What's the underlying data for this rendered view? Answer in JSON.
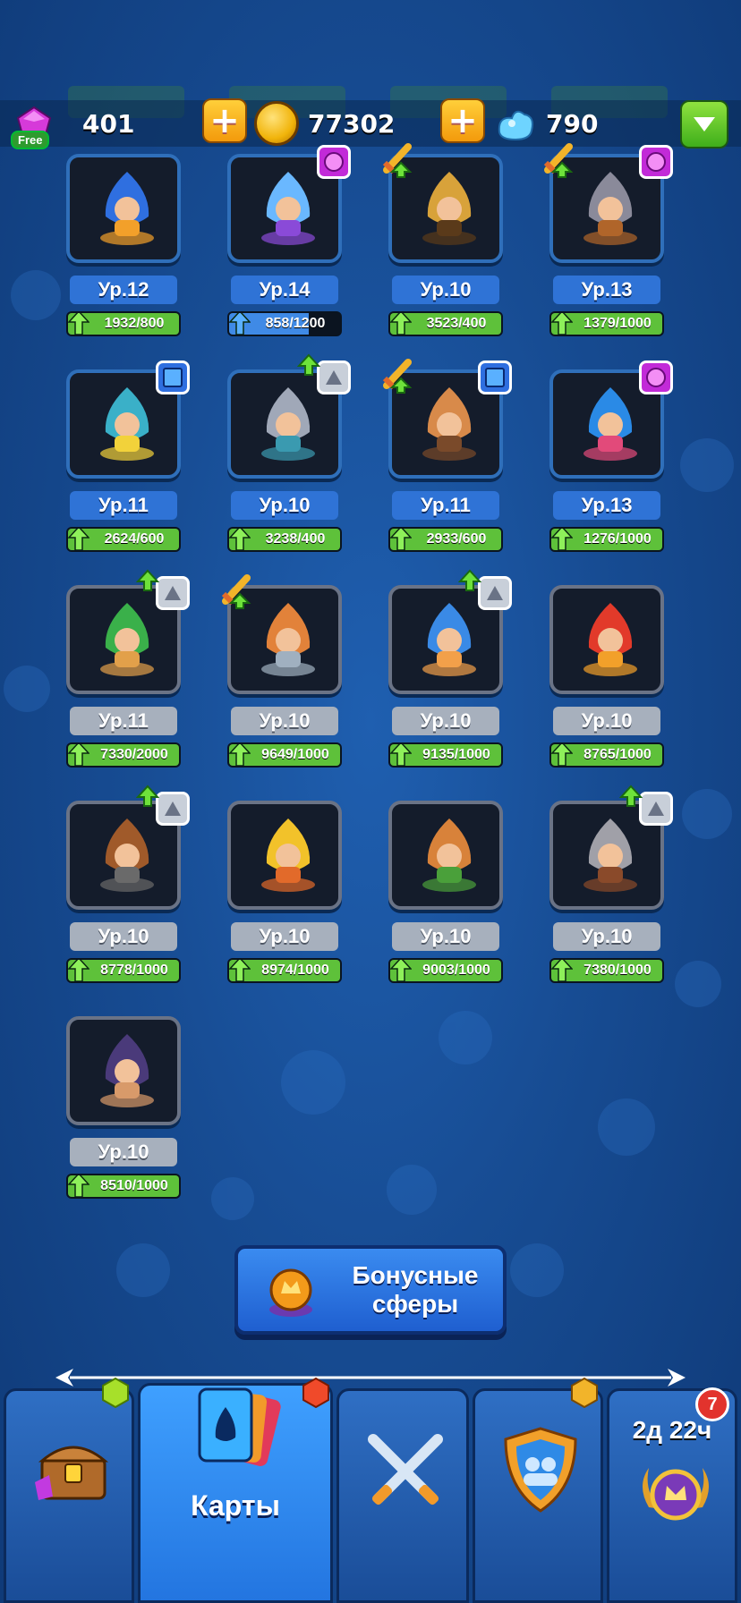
{
  "resources": {
    "gems": "401",
    "gems_free_label": "Free",
    "coins": "77302",
    "crystals": "790"
  },
  "colors": {
    "card_blue_border": "#2f6fba",
    "card_grey_border": "#6a7386",
    "level_blue": "#2f73d6",
    "level_grey": "#a7b0bd",
    "progress_green": "#5ec13a",
    "progress_blue": "#3f8ae6"
  },
  "cards": [
    {
      "level": "Ур.12",
      "progress": "1932/800",
      "fill": 1.0,
      "style": "blue",
      "badge": "",
      "sword": false,
      "up": false,
      "art": "banner",
      "bar": "green"
    },
    {
      "level": "Ур.14",
      "progress": "858/1200",
      "fill": 0.715,
      "style": "blue",
      "badge": "purple",
      "sword": false,
      "up": false,
      "art": "cauldron",
      "bar": "blue"
    },
    {
      "level": "Ур.10",
      "progress": "3523/400",
      "fill": 1.0,
      "style": "blue",
      "badge": "",
      "sword": true,
      "up": false,
      "art": "golem",
      "bar": "green"
    },
    {
      "level": "Ур.13",
      "progress": "1379/1000",
      "fill": 1.0,
      "style": "blue",
      "badge": "purple",
      "sword": true,
      "up": false,
      "art": "cannon",
      "bar": "green"
    },
    {
      "level": "Ур.11",
      "progress": "2624/600",
      "fill": 1.0,
      "style": "blue",
      "badge": "blue",
      "sword": false,
      "up": false,
      "art": "angel",
      "bar": "green"
    },
    {
      "level": "Ур.10",
      "progress": "3238/400",
      "fill": 1.0,
      "style": "blue",
      "badge": "grey",
      "sword": false,
      "up": true,
      "art": "knight",
      "bar": "green"
    },
    {
      "level": "Ур.11",
      "progress": "2933/600",
      "fill": 1.0,
      "style": "blue",
      "badge": "blue",
      "sword": true,
      "up": false,
      "art": "monk",
      "bar": "green"
    },
    {
      "level": "Ур.13",
      "progress": "1276/1000",
      "fill": 1.0,
      "style": "blue",
      "badge": "purple",
      "sword": false,
      "up": false,
      "art": "mage",
      "bar": "green"
    },
    {
      "level": "Ур.11",
      "progress": "7330/2000",
      "fill": 1.0,
      "style": "grey",
      "badge": "grey",
      "sword": false,
      "up": true,
      "art": "druid",
      "bar": "green"
    },
    {
      "level": "Ур.10",
      "progress": "9649/1000",
      "fill": 1.0,
      "style": "grey",
      "badge": "",
      "sword": true,
      "up": false,
      "art": "gasmask",
      "bar": "green"
    },
    {
      "level": "Ур.10",
      "progress": "9135/1000",
      "fill": 1.0,
      "style": "grey",
      "badge": "grey",
      "sword": false,
      "up": true,
      "art": "icemage",
      "bar": "green"
    },
    {
      "level": "Ур.10",
      "progress": "8765/1000",
      "fill": 1.0,
      "style": "grey",
      "badge": "",
      "sword": false,
      "up": false,
      "art": "firemage",
      "bar": "green"
    },
    {
      "level": "Ур.10",
      "progress": "8778/1000",
      "fill": 1.0,
      "style": "grey",
      "badge": "grey",
      "sword": false,
      "up": true,
      "art": "boar",
      "bar": "green"
    },
    {
      "level": "Ур.10",
      "progress": "8974/1000",
      "fill": 1.0,
      "style": "grey",
      "badge": "",
      "sword": false,
      "up": false,
      "art": "lightning",
      "bar": "green"
    },
    {
      "level": "Ур.10",
      "progress": "9003/1000",
      "fill": 1.0,
      "style": "grey",
      "badge": "",
      "sword": false,
      "up": false,
      "art": "shaman",
      "bar": "green"
    },
    {
      "level": "Ур.10",
      "progress": "7380/1000",
      "fill": 1.0,
      "style": "grey",
      "badge": "grey",
      "sword": false,
      "up": true,
      "art": "warrior",
      "bar": "green"
    },
    {
      "level": "Ур.10",
      "progress": "8510/1000",
      "fill": 1.0,
      "style": "grey",
      "badge": "",
      "sword": false,
      "up": false,
      "art": "bandit",
      "bar": "green"
    }
  ],
  "bonus_button": {
    "label_line1": "Бонусные",
    "label_line2": "сферы"
  },
  "nav": {
    "tabs": [
      {
        "name": "chest",
        "label": ""
      },
      {
        "name": "cards",
        "label": "Карты"
      },
      {
        "name": "battle",
        "label": ""
      },
      {
        "name": "clan",
        "label": ""
      },
      {
        "name": "event",
        "label": ""
      }
    ],
    "event_timer": "2д 22ч",
    "event_notification": "7"
  }
}
